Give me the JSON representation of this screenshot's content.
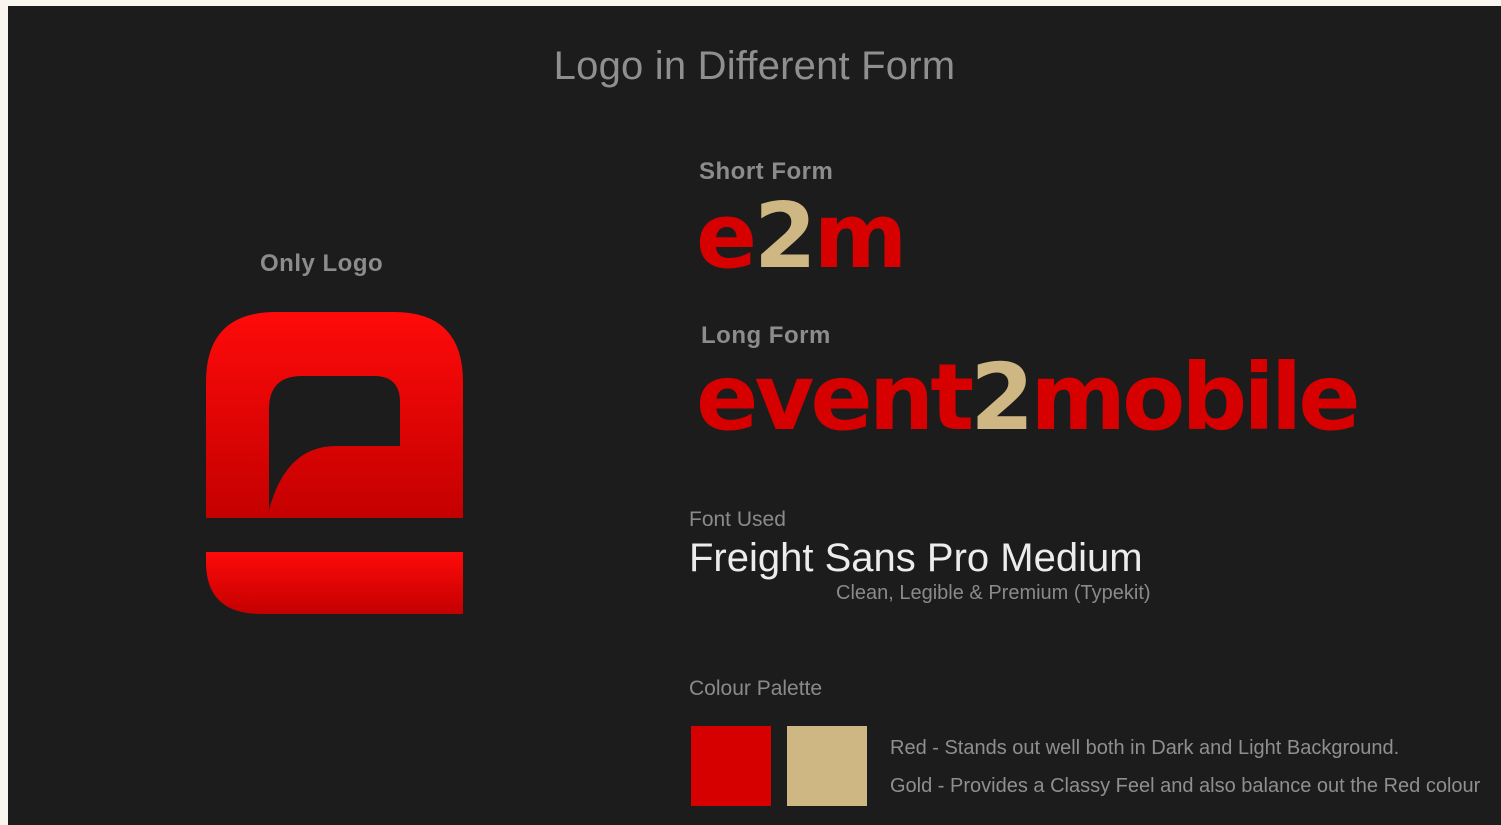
{
  "title": "Logo in Different Form",
  "only_logo": {
    "label": "Only Logo"
  },
  "short_form": {
    "label": "Short Form",
    "part_red_1": "e",
    "part_gold": "2",
    "part_red_2": "m"
  },
  "long_form": {
    "label": "Long Form",
    "part_red_1": "event",
    "part_gold": "2",
    "part_red_2": "mobile"
  },
  "font": {
    "label": "Font Used",
    "name": "Freight Sans Pro Medium",
    "note": "Clean, Legible & Premium (Typekit)"
  },
  "palette": {
    "label": "Colour Palette",
    "red_color": "#d60000",
    "gold_color": "#cfb784",
    "red_desc": "Red - Stands out well both in Dark and Light Background.",
    "gold_desc": "Gold - Provides a Classy Feel and also balance out the Red colour"
  }
}
